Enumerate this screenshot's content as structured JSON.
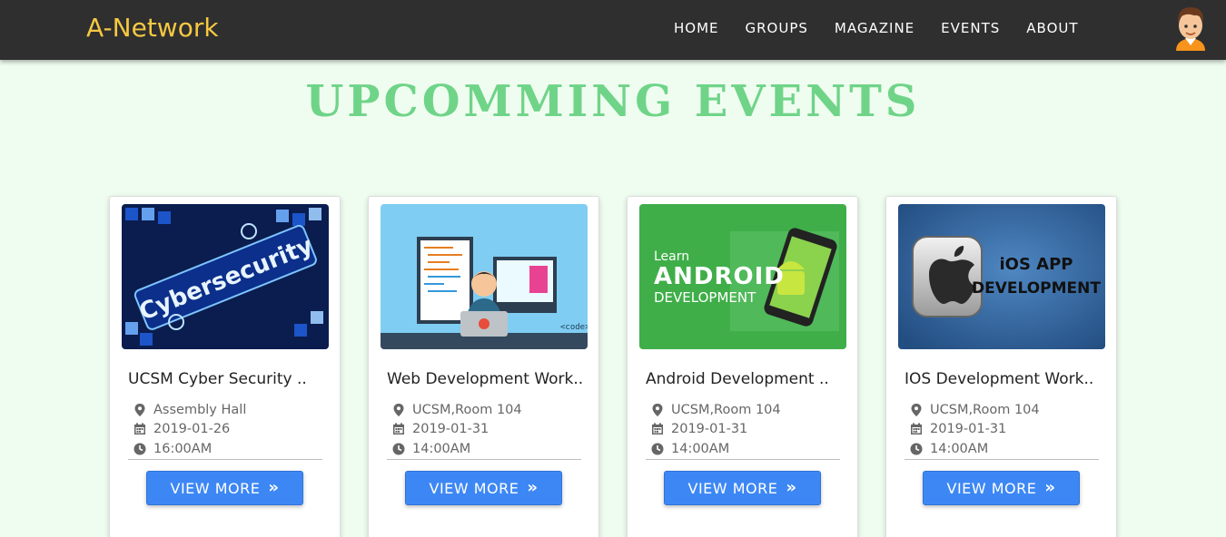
{
  "nav": {
    "brand": "A-Network",
    "links": [
      "HOME",
      "GROUPS",
      "MAGAZINE",
      "EVENTS",
      "ABOUT"
    ],
    "avatar_icon": "user-avatar-icon"
  },
  "page": {
    "heading": "UPCOMMING EVENTS"
  },
  "colors": {
    "nav_bg": "#2f2f2f",
    "brand": "#f5c842",
    "heading": "#6fd488",
    "page_bg": "#effdf0",
    "button": "#3d87f5"
  },
  "events": [
    {
      "title": "UCSM Cyber Security ..",
      "location": "Assembly Hall",
      "date": "2019-01-26",
      "time": "16:00AM",
      "button": "VIEW MORE",
      "image_text": "Cybersecurity"
    },
    {
      "title": "Web Development Work..",
      "location": "UCSM,Room 104",
      "date": "2019-01-31",
      "time": "14:00AM",
      "button": "VIEW MORE",
      "image_text": "<code>"
    },
    {
      "title": "Android Development ..",
      "location": "UCSM,Room 104",
      "date": "2019-01-31",
      "time": "14:00AM",
      "button": "VIEW MORE",
      "image_text": "Learn ANDROID DEVELOPMENT"
    },
    {
      "title": "IOS Development Work..",
      "location": "UCSM,Room 104",
      "date": "2019-01-31",
      "time": "14:00AM",
      "button": "VIEW MORE",
      "image_text": "iOS APP DEVELOPMENT"
    }
  ],
  "icons": {
    "location": "map-marker-icon",
    "date": "calendar-icon",
    "time": "clock-icon",
    "button": "double-chevron-right-icon"
  }
}
